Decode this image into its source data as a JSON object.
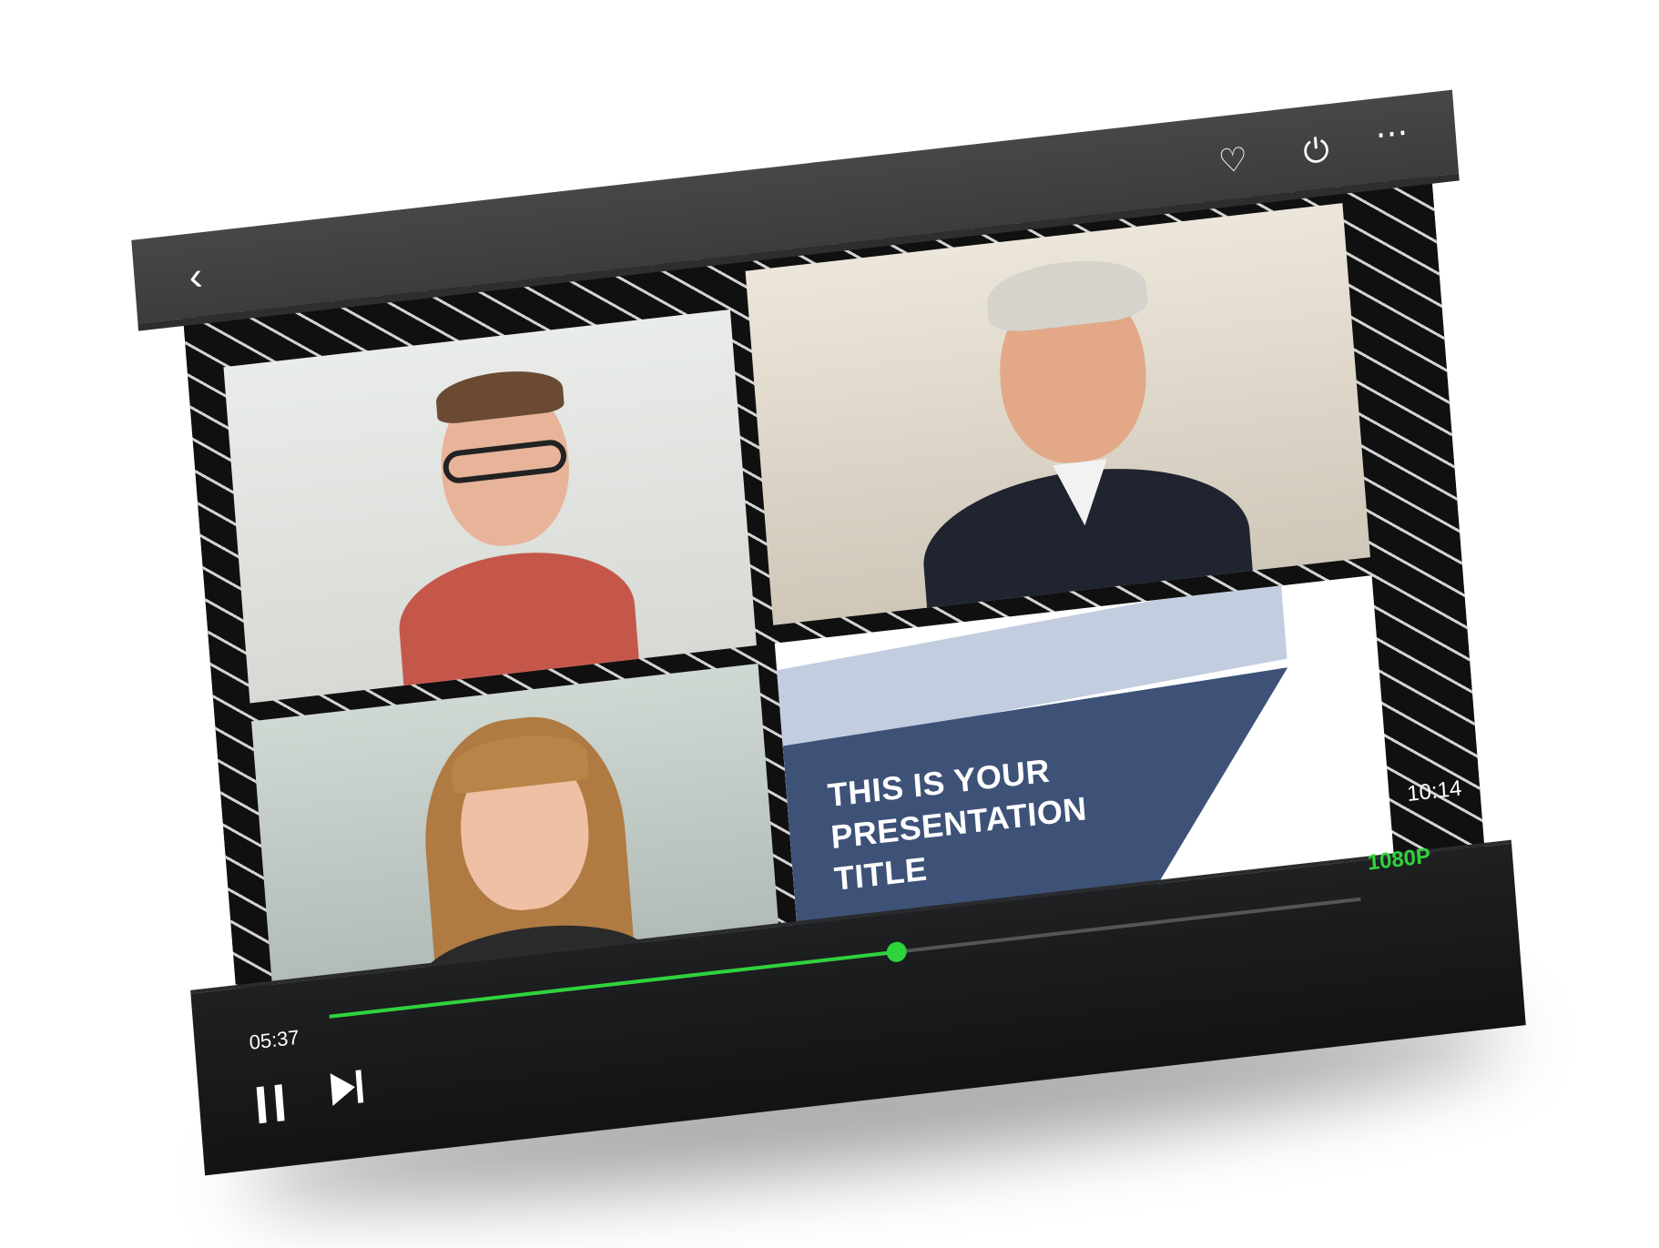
{
  "player": {
    "top_controls": {
      "back_icon": "chevron-left-icon",
      "heart_icon": "heart-icon",
      "power_icon": "power-icon",
      "more_icon": "more-horizontal-icon"
    },
    "slide": {
      "title_lines": [
        "THIS IS YOUR",
        "PRESENTATION",
        "TITLE"
      ],
      "colors": {
        "light_band": "#c3cde0",
        "dark_band": "#3e5278"
      }
    },
    "playback": {
      "current_time": "05:37",
      "total_time": "10:14",
      "quality": "1080P",
      "progress_fraction": 0.55,
      "accent_color": "#2fd33c"
    },
    "bottom_controls": {
      "pause_icon": "pause-icon",
      "next_icon": "skip-next-icon"
    }
  }
}
